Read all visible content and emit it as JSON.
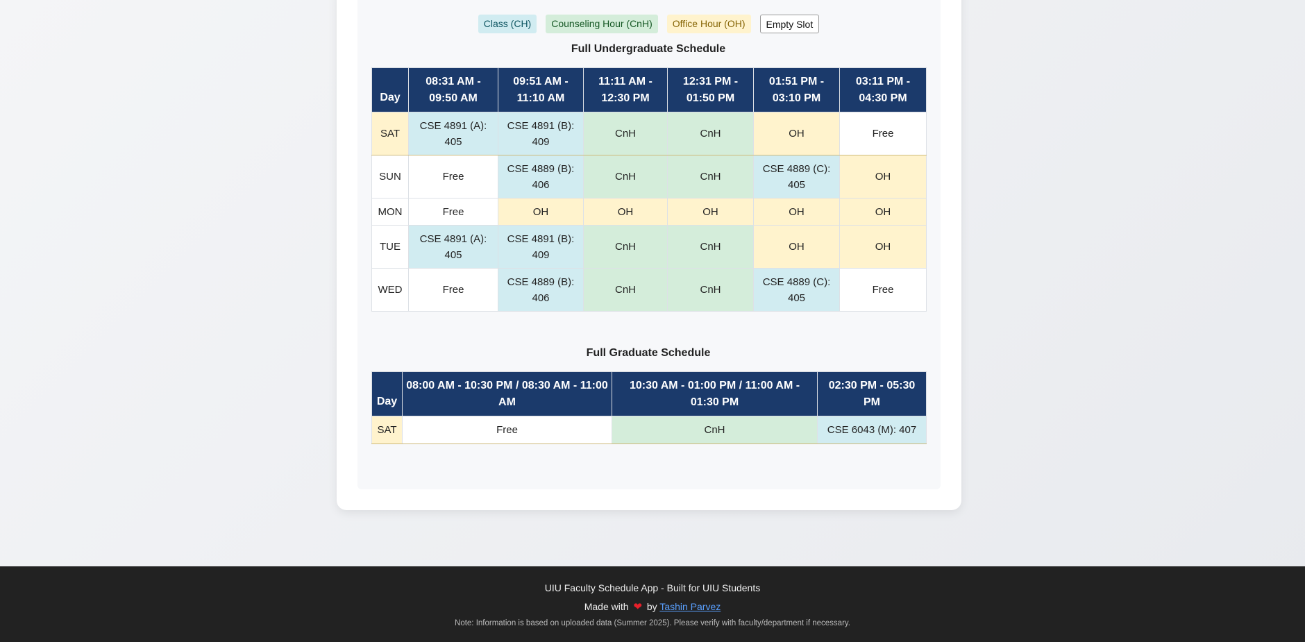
{
  "legend": {
    "class": "Class (CH)",
    "cnh": "Counseling Hour (CnH)",
    "oh": "Office Hour (OH)",
    "empty": "Empty Slot"
  },
  "colors": {
    "header_bg": "#1b3a6b",
    "class": "#d1ecf1",
    "cnh": "#d4edda",
    "oh": "#fff3cd",
    "free": "#ffffff",
    "footer_bg": "#222222",
    "link": "#5aa0ff"
  },
  "undergrad": {
    "title": "Full Undergraduate Schedule",
    "day_header": "Day",
    "slots": [
      "08:31 AM - 09:50 AM",
      "09:51 AM - 11:10 AM",
      "11:11 AM - 12:30 PM",
      "12:31 PM - 01:50 PM",
      "01:51 PM - 03:10 PM",
      "03:11 PM - 04:30 PM"
    ],
    "rows": [
      {
        "day": "SAT",
        "cells": [
          "CSE 4891 (A): 405",
          "CSE 4891 (B): 409",
          "CnH",
          "CnH",
          "OH",
          "Free"
        ]
      },
      {
        "day": "SUN",
        "cells": [
          "Free",
          "CSE 4889 (B): 406",
          "CnH",
          "CnH",
          "CSE 4889 (C): 405",
          "OH"
        ]
      },
      {
        "day": "MON",
        "cells": [
          "Free",
          "OH",
          "OH",
          "OH",
          "OH",
          "OH"
        ]
      },
      {
        "day": "TUE",
        "cells": [
          "CSE 4891 (A): 405",
          "CSE 4891 (B): 409",
          "CnH",
          "CnH",
          "OH",
          "OH"
        ]
      },
      {
        "day": "WED",
        "cells": [
          "Free",
          "CSE 4889 (B): 406",
          "CnH",
          "CnH",
          "CSE 4889 (C): 405",
          "Free"
        ]
      }
    ]
  },
  "grad": {
    "title": "Full Graduate Schedule",
    "day_header": "Day",
    "slots": [
      "08:00 AM - 10:30 PM / 08:30 AM - 11:00 AM",
      "10:30 AM - 01:00 PM / 11:00 AM - 01:30 PM",
      "02:30 PM - 05:30 PM"
    ],
    "rows": [
      {
        "day": "SAT",
        "cells": [
          "Free",
          "CnH",
          "CSE 6043 (M): 407"
        ]
      }
    ]
  },
  "footer": {
    "line1": "UIU Faculty Schedule App - Built for UIU Students",
    "made_with": "Made with",
    "heart_icon": "heart-icon",
    "by": "by",
    "author": "Tashin Parvez",
    "note": "Note: Information is based on uploaded data (Summer 2025). Please verify with faculty/department if necessary."
  }
}
